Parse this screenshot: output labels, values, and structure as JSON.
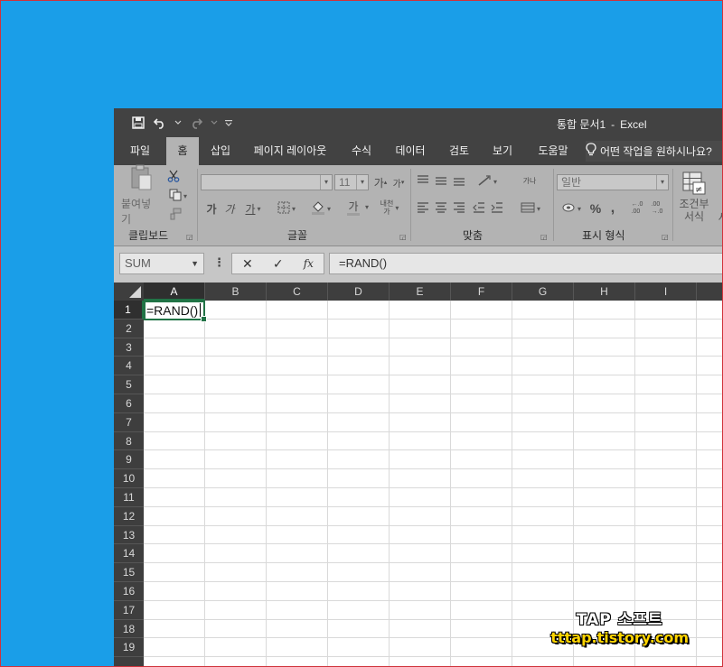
{
  "window": {
    "doc_name": "통합 문서1",
    "separator": "-",
    "app_name": "Excel"
  },
  "qat": {
    "customize_glyph": "⌄"
  },
  "tabs": [
    {
      "label": "파일"
    },
    {
      "label": "홈"
    },
    {
      "label": "삽입"
    },
    {
      "label": "페이지 레이아웃"
    },
    {
      "label": "수식"
    },
    {
      "label": "데이터"
    },
    {
      "label": "검토"
    },
    {
      "label": "보기"
    },
    {
      "label": "도움말"
    }
  ],
  "tell_me": "어떤 작업을 원하시나요?",
  "ribbon": {
    "clipboard": {
      "paste_label": "붙여넣기",
      "group_label": "클립보드"
    },
    "font": {
      "font_name": "",
      "font_size": "11",
      "grow": "가",
      "shrink": "가",
      "bold": "가",
      "italic": "가",
      "underline": "가",
      "font_color": "가",
      "phonetic": "내천\n가",
      "group_label": "글꼴"
    },
    "alignment": {
      "group_label": "맞춤",
      "wrap_glyph": "가나"
    },
    "number": {
      "format": "일반",
      "percent": "%",
      "comma": ",",
      "inc": "←.0\n.00",
      "dec": ".00\n→.0",
      "group_label": "표시 형식"
    },
    "styles": {
      "conditional_label1": "조건부",
      "conditional_label2": "서식",
      "next_label": "서"
    }
  },
  "formula_bar": {
    "name_box": "SUM",
    "more": "⋮",
    "cancel": "✕",
    "enter": "✓",
    "fx": "fx",
    "formula": "=RAND()"
  },
  "sheet": {
    "columns": [
      "A",
      "B",
      "C",
      "D",
      "E",
      "F",
      "G",
      "H",
      "I"
    ],
    "rows": [
      "1",
      "2",
      "3",
      "4",
      "5",
      "6",
      "7",
      "8",
      "9",
      "10",
      "11",
      "12",
      "13",
      "14",
      "15",
      "16",
      "17",
      "18",
      "19"
    ],
    "active_cell_text": "=RAND()"
  },
  "watermark": {
    "line1": "TAP 소프트",
    "line2": "tttap.tistory.com"
  },
  "colors": {
    "desktop": "#1a9ee8",
    "title_bar": "#424242",
    "ribbon": "#b3b3b3",
    "accent": "#217346"
  }
}
